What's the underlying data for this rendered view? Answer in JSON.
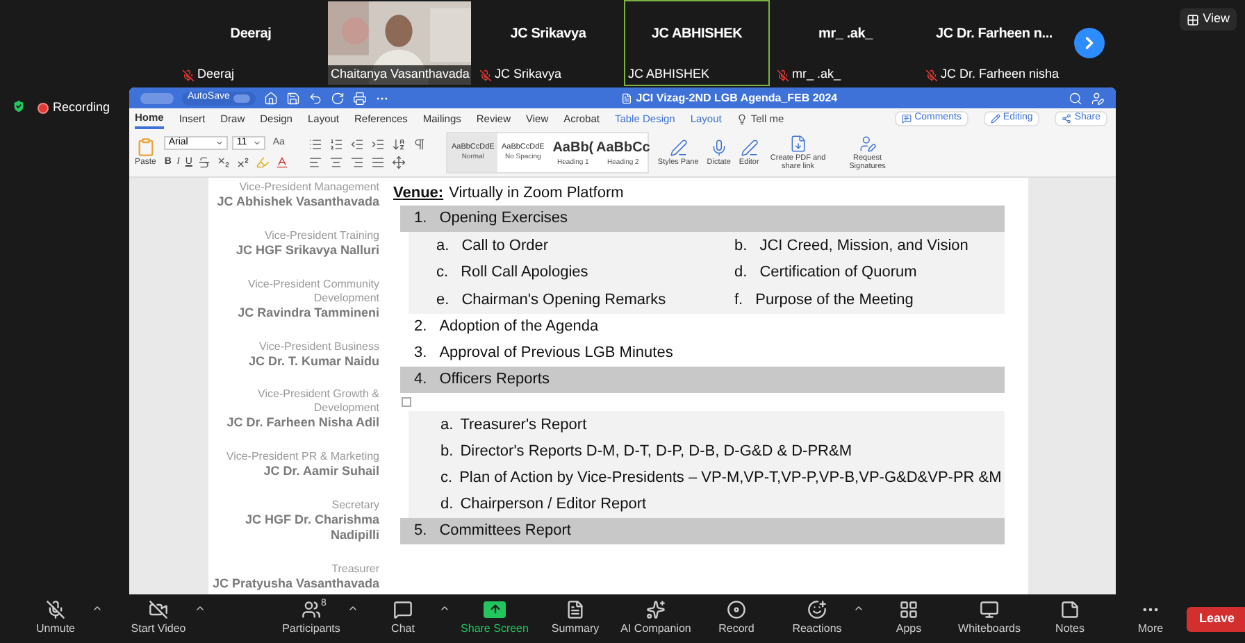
{
  "participants": [
    {
      "kind": "name",
      "name": "Deeraj",
      "label": "Deeraj",
      "muted": true,
      "speaking": false
    },
    {
      "kind": "video",
      "label": "Chaitanya Vasanthavada",
      "muted": false,
      "speaking": false
    },
    {
      "kind": "name",
      "name": "JC Srikavya",
      "label": "JC Srikavya",
      "muted": true,
      "speaking": false
    },
    {
      "kind": "name",
      "name": "JC ABHISHEK",
      "label": "JC ABHISHEK",
      "muted": false,
      "speaking": true
    },
    {
      "kind": "name",
      "name": "mr_ .ak_",
      "label": "mr_ .ak_",
      "muted": true,
      "speaking": false
    },
    {
      "kind": "name",
      "name": "JC Dr. Farheen n...",
      "label": "JC Dr. Farheen nisha",
      "muted": true,
      "speaking": false
    }
  ],
  "view_button": "View",
  "recording": "Recording",
  "word": {
    "autosave": "AutoSave",
    "title": "JCI Vizag-2ND LGB Agenda_FEB 2024",
    "tabs": [
      {
        "label": "Home",
        "selected": true,
        "contextual": false
      },
      {
        "label": "Insert",
        "selected": false,
        "contextual": false
      },
      {
        "label": "Draw",
        "selected": false,
        "contextual": false
      },
      {
        "label": "Design",
        "selected": false,
        "contextual": false
      },
      {
        "label": "Layout",
        "selected": false,
        "contextual": false
      },
      {
        "label": "References",
        "selected": false,
        "contextual": false
      },
      {
        "label": "Mailings",
        "selected": false,
        "contextual": false
      },
      {
        "label": "Review",
        "selected": false,
        "contextual": false
      },
      {
        "label": "View",
        "selected": false,
        "contextual": false
      },
      {
        "label": "Acrobat",
        "selected": false,
        "contextual": false
      },
      {
        "label": "Table Design",
        "selected": false,
        "contextual": true
      },
      {
        "label": "Layout",
        "selected": false,
        "contextual": true
      }
    ],
    "tell_me": "Tell me",
    "header_buttons": [
      "Comments",
      "Editing",
      "Share"
    ],
    "paste": "Paste",
    "font": "Arial",
    "font_size": "11",
    "change_case": "Aa",
    "format_buttons": [
      "B",
      "I",
      "U"
    ],
    "styles": [
      {
        "preview": "AaBbCcDdE",
        "name": "Normal",
        "selected": true,
        "kind": "body"
      },
      {
        "preview": "AaBbCcDdE",
        "name": "No Spacing",
        "selected": false,
        "kind": "body"
      },
      {
        "preview": "AaBb(",
        "name": "Heading 1",
        "selected": false,
        "kind": "heading"
      },
      {
        "preview": "AaBbCc",
        "name": "Heading 2",
        "selected": false,
        "kind": "heading"
      }
    ],
    "big_buttons": [
      "Styles Pane",
      "Dictate",
      "Editor",
      "Create PDF and share link",
      "Request Signatures"
    ]
  },
  "document": {
    "officers": [
      {
        "role": "Vice-President Management",
        "name": "JC Abhishek Vasanthavada"
      },
      {
        "role": "Vice-President Training",
        "name": "JC HGF Srikavya Nalluri"
      },
      {
        "role": "Vice-President Community Development",
        "name": "JC Ravindra Tammineni"
      },
      {
        "role": "Vice-President Business",
        "name": "JC Dr. T. Kumar Naidu"
      },
      {
        "role": "Vice-President Growth & Development",
        "name": "JC Dr. Farheen Nisha Adil"
      },
      {
        "role": "Vice-President PR & Marketing",
        "name": "JC Dr. Aamir Suhail"
      },
      {
        "role": "Secretary",
        "name": "JC HGF Dr. Charishma Nadipilli"
      },
      {
        "role": "Treasurer",
        "name": "JC Pratyusha Vasanthavada"
      }
    ],
    "venue_label": "Venue:",
    "venue": "Virtually in Zoom Platform",
    "agenda": [
      {
        "number": "1.",
        "title": "Opening Exercises",
        "shaded": true,
        "kind": "two-column",
        "children": [
          {
            "marker": "a.",
            "text": "Call to Order"
          },
          {
            "marker": "b.",
            "text": "JCI Creed, Mission, and Vision"
          },
          {
            "marker": "c.",
            "text": "Roll Call Apologies"
          },
          {
            "marker": "d.",
            "text": "Certification of Quorum"
          },
          {
            "marker": "e.",
            "text": "Chairman's Opening Remarks"
          },
          {
            "marker": "f.",
            "text": "Purpose of the Meeting"
          }
        ]
      },
      {
        "number": "2.",
        "title": "Adoption of the Agenda",
        "shaded": false
      },
      {
        "number": "3.",
        "title": "Approval of Previous LGB Minutes",
        "shaded": false
      },
      {
        "number": "4.",
        "title": "Officers Reports",
        "shaded": true,
        "kind": "single",
        "children": [
          {
            "marker": "a.",
            "text": "Treasurer's Report"
          },
          {
            "marker": "b.",
            "text": "Director's Reports D-M, D-T, D-P, D-B, D-G&D & D-PR&M"
          },
          {
            "marker": "c.",
            "text": "Plan of Action by Vice-Presidents – VP-M,VP-T,VP-P,VP-B,VP-G&D&VP-PR &M"
          },
          {
            "marker": "d.",
            "text": "Chairperson / Editor Report"
          }
        ]
      },
      {
        "number": "5.",
        "title": "Committees Report",
        "shaded": true
      }
    ]
  },
  "toolbar": [
    {
      "label": "Unmute",
      "caret": true,
      "kind": "muted"
    },
    {
      "label": "Start Video",
      "caret": true,
      "kind": "video-off"
    },
    {
      "label": "Participants",
      "caret": true,
      "kind": "normal",
      "count": "8"
    },
    {
      "label": "Chat",
      "caret": true,
      "kind": "normal"
    },
    {
      "label": "Share Screen",
      "caret": false,
      "kind": "share"
    },
    {
      "label": "Summary",
      "caret": false,
      "kind": "normal"
    },
    {
      "label": "AI Companion",
      "caret": false,
      "kind": "normal"
    },
    {
      "label": "Record",
      "caret": false,
      "kind": "normal"
    },
    {
      "label": "Reactions",
      "caret": true,
      "kind": "normal"
    },
    {
      "label": "Apps",
      "caret": false,
      "kind": "normal"
    },
    {
      "label": "Whiteboards",
      "caret": false,
      "kind": "normal"
    },
    {
      "label": "Notes",
      "caret": false,
      "kind": "normal"
    },
    {
      "label": "More",
      "caret": false,
      "kind": "normal"
    }
  ],
  "leave": "Leave"
}
